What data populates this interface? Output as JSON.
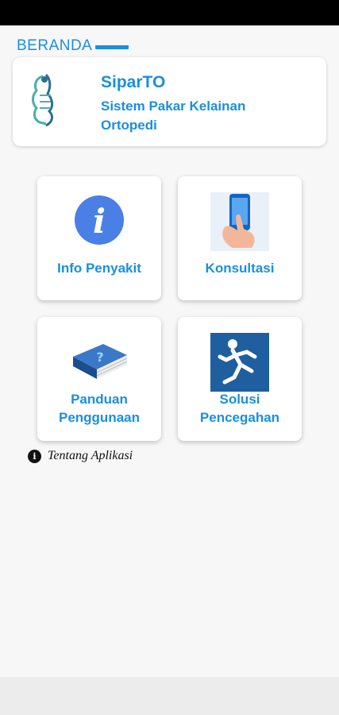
{
  "section": {
    "title": "BERANDA"
  },
  "app": {
    "name": "SiparTO",
    "subtitle": "Sistem Pakar Kelainan Ortopedi",
    "logo_icon": "spine-logo-icon"
  },
  "menu": [
    {
      "label": "Info Penyakit",
      "icon": "info-icon"
    },
    {
      "label": "Konsultasi",
      "icon": "phone-tap-icon"
    },
    {
      "label": "Panduan Penggunaan",
      "icon": "help-book-icon"
    },
    {
      "label": "Solusi Pencegahan",
      "icon": "runner-anatomy-icon"
    }
  ],
  "about": {
    "label": "Tentang Aplikasi",
    "icon": "info-small-icon"
  },
  "colors": {
    "accent": "#1a8fe0",
    "background": "#f7f7f7"
  }
}
